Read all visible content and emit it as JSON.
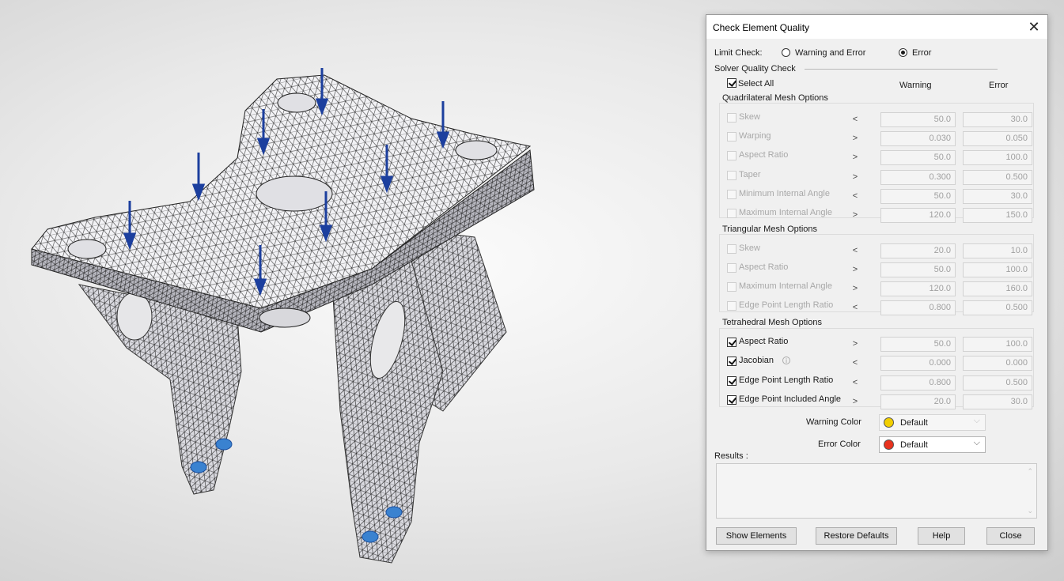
{
  "dialog": {
    "title": "Check Element Quality",
    "limit_check": {
      "label": "Limit Check:",
      "options": [
        "Warning and Error",
        "Error"
      ],
      "selected": "Error"
    },
    "solver_quality_check": "Solver Quality Check",
    "select_all": {
      "label": "Select All",
      "checked": true
    },
    "columns": {
      "warning": "Warning",
      "error": "Error"
    },
    "quad": {
      "title": "Quadrilateral Mesh Options",
      "rows": [
        {
          "label": "Skew",
          "op": "<",
          "warning": "50.0",
          "error": "30.0",
          "checked": false,
          "enabled": false
        },
        {
          "label": "Warping",
          "op": ">",
          "warning": "0.030",
          "error": "0.050",
          "checked": false,
          "enabled": false
        },
        {
          "label": "Aspect Ratio",
          "op": ">",
          "warning": "50.0",
          "error": "100.0",
          "checked": false,
          "enabled": false
        },
        {
          "label": "Taper",
          "op": ">",
          "warning": "0.300",
          "error": "0.500",
          "checked": false,
          "enabled": false
        },
        {
          "label": "Minimum Internal Angle",
          "op": "<",
          "warning": "50.0",
          "error": "30.0",
          "checked": false,
          "enabled": false
        },
        {
          "label": "Maximum Internal Angle",
          "op": ">",
          "warning": "120.0",
          "error": "150.0",
          "checked": false,
          "enabled": false
        }
      ]
    },
    "tri": {
      "title": "Triangular Mesh Options",
      "rows": [
        {
          "label": "Skew",
          "op": "<",
          "warning": "20.0",
          "error": "10.0",
          "checked": false,
          "enabled": false
        },
        {
          "label": "Aspect Ratio",
          "op": ">",
          "warning": "50.0",
          "error": "100.0",
          "checked": false,
          "enabled": false
        },
        {
          "label": "Maximum Internal Angle",
          "op": ">",
          "warning": "120.0",
          "error": "160.0",
          "checked": false,
          "enabled": false
        },
        {
          "label": "Edge Point Length Ratio",
          "op": "<",
          "warning": "0.800",
          "error": "0.500",
          "checked": false,
          "enabled": false
        }
      ]
    },
    "tet": {
      "title": "Tetrahedral Mesh Options",
      "rows": [
        {
          "label": "Aspect Ratio",
          "op": ">",
          "warning": "50.0",
          "error": "100.0",
          "checked": true,
          "enabled": true
        },
        {
          "label": "Jacobian",
          "op": "<",
          "warning": "0.000",
          "error": "0.000",
          "checked": true,
          "enabled": true,
          "info_icon": "info-icon"
        },
        {
          "label": "Edge Point Length Ratio",
          "op": "<",
          "warning": "0.800",
          "error": "0.500",
          "checked": true,
          "enabled": true
        },
        {
          "label": "Edge Point Included Angle",
          "op": ">",
          "warning": "20.0",
          "error": "30.0",
          "checked": true,
          "enabled": true
        }
      ]
    },
    "warning_color": {
      "label": "Warning Color",
      "value": "Default",
      "swatch": "#f2cf00",
      "enabled": false
    },
    "error_color": {
      "label": "Error Color",
      "value": "Default",
      "swatch": "#e8321e",
      "enabled": true
    },
    "results_label": "Results :",
    "buttons": {
      "show_elements": "Show Elements",
      "restore_defaults": "Restore Defaults",
      "help": "Help",
      "close": "Close"
    }
  },
  "viewport": {
    "model": "mesh-bracket",
    "load_arrow_color": "#1c3f9e",
    "constraint_color": "#3a82d0"
  }
}
